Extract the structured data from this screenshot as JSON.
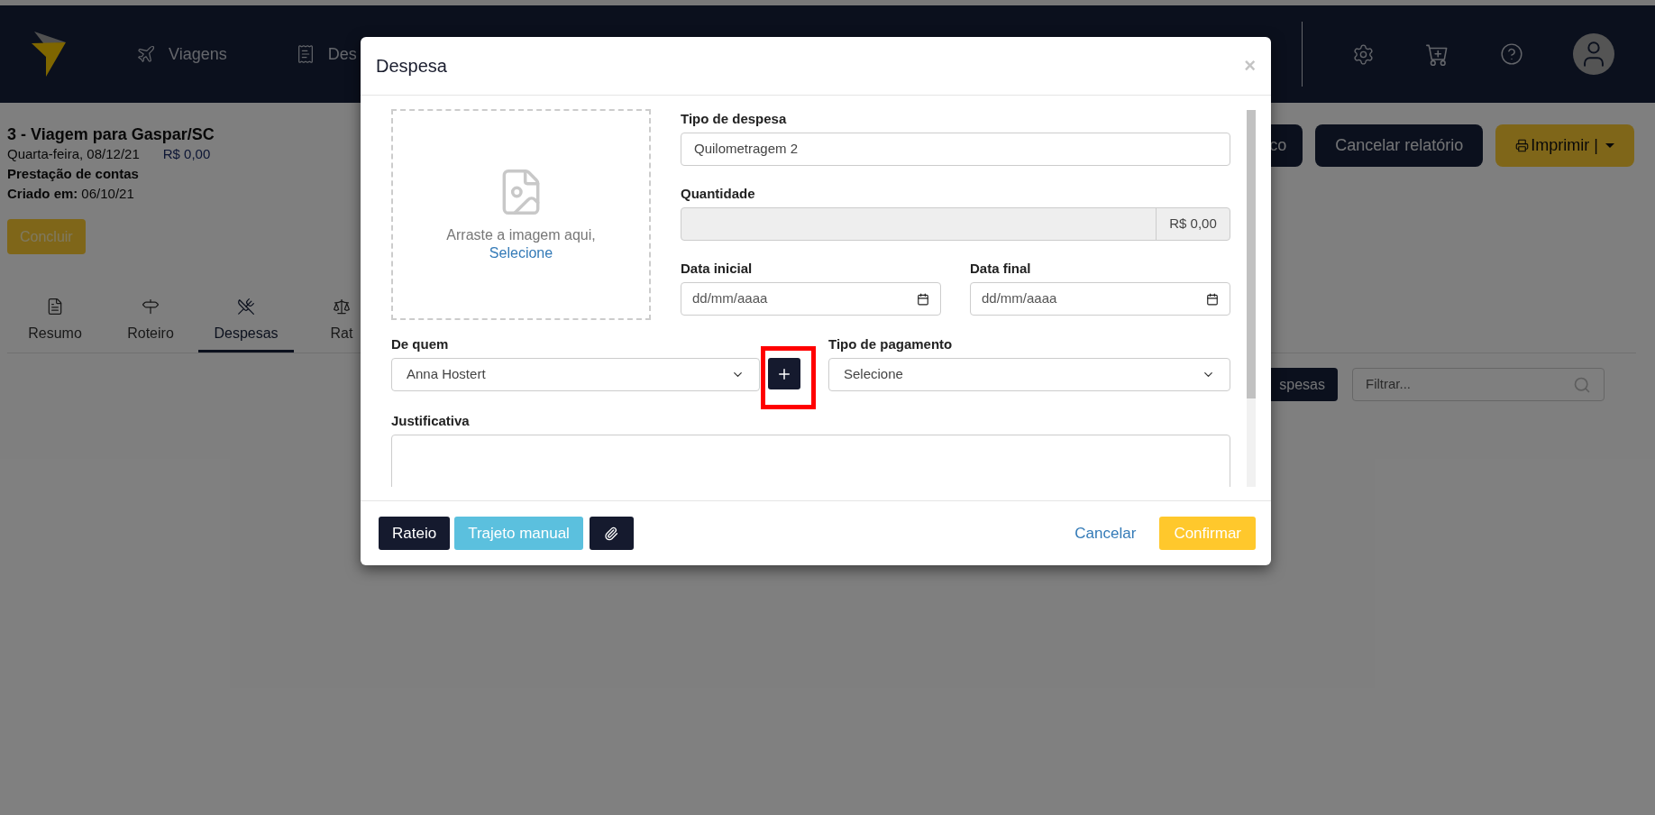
{
  "top_nav": {
    "items": [
      {
        "label": "Viagens"
      },
      {
        "label": "Des"
      }
    ]
  },
  "trip": {
    "title": "3 - Viagem para Gaspar/SC",
    "date": "Quarta-feira, 08/12/21",
    "amount": "R$ 0,00",
    "type": "Prestação de contas",
    "created_label": "Criado em:",
    "created_date": "06/10/21"
  },
  "complete_button": "Concluir",
  "tabs": [
    {
      "label": "Resumo",
      "selected": false
    },
    {
      "label": "Roteiro",
      "selected": false
    },
    {
      "label": "Despesas",
      "selected": true
    },
    {
      "label": "Rat",
      "selected": false
    }
  ],
  "actions": [
    {
      "label": "co",
      "kind": "dark"
    },
    {
      "label": "Cancelar relatório",
      "kind": "dark"
    },
    {
      "label": "Imprimir |",
      "kind": "print"
    }
  ],
  "list_toolbar": {
    "button": "spesas",
    "filter_placeholder": "Filtrar..."
  },
  "modal": {
    "title": "Despesa",
    "close": "×",
    "dropzone": {
      "text": "Arraste a imagem aqui,",
      "link": "Selecione"
    },
    "expense_type": {
      "label": "Tipo de despesa",
      "value": "Quilometragem 2"
    },
    "quantity": {
      "label": "Quantidade",
      "addon": "R$ 0,00",
      "disabled": true
    },
    "start_date": {
      "label": "Data inicial",
      "placeholder": "dd/mm/aaaa"
    },
    "end_date": {
      "label": "Data final",
      "placeholder": "dd/mm/aaaa"
    },
    "from_whom": {
      "label": "De quem",
      "value": "Anna Hostert"
    },
    "add_person": {
      "highlighted": true
    },
    "payment_type": {
      "label": "Tipo de pagamento",
      "value": "Selecione"
    },
    "justification": {
      "label": "Justificativa"
    },
    "footer": {
      "buttons": [
        {
          "label": "Rateio",
          "kind": "dark"
        },
        {
          "label": "Trajeto manual",
          "kind": "info"
        },
        {
          "kind": "attach"
        }
      ],
      "cancel": "Cancelar",
      "confirm": "Confirmar"
    }
  }
}
